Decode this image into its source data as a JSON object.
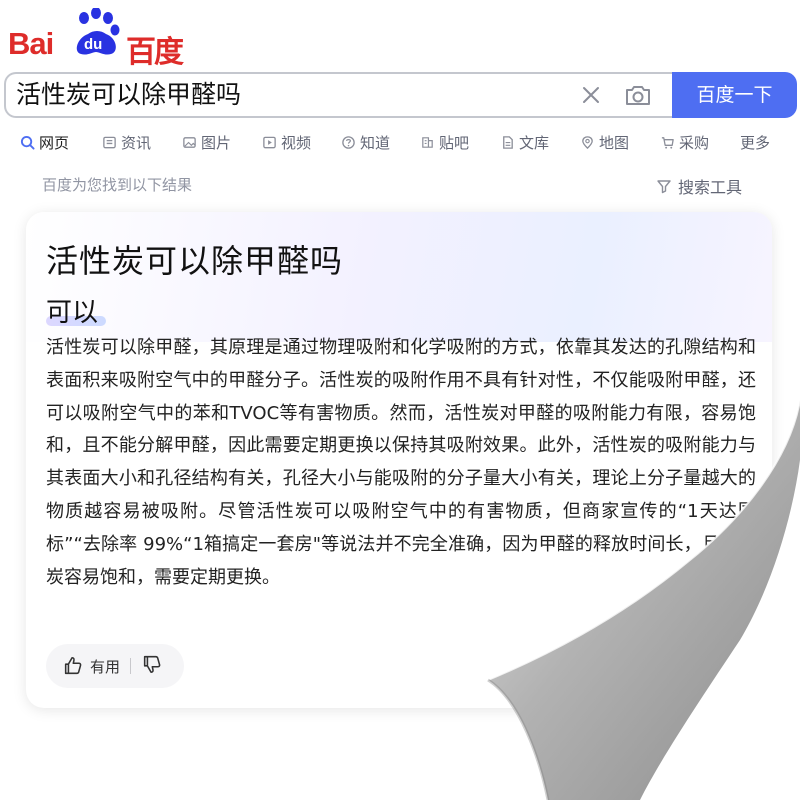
{
  "logo": {
    "text_bai": "Bai",
    "text_du": "du",
    "text_cn": "百度"
  },
  "search": {
    "query": "活性炭可以除甲醛吗",
    "button_label": "百度一下"
  },
  "tabs": [
    {
      "label": "网页",
      "icon": "search-icon"
    },
    {
      "label": "资讯",
      "icon": "news-icon"
    },
    {
      "label": "图片",
      "icon": "image-icon"
    },
    {
      "label": "视频",
      "icon": "video-icon"
    },
    {
      "label": "知道",
      "icon": "question-icon"
    },
    {
      "label": "贴吧",
      "icon": "tieba-icon"
    },
    {
      "label": "文库",
      "icon": "doc-icon"
    },
    {
      "label": "地图",
      "icon": "map-icon"
    },
    {
      "label": "采购",
      "icon": "cart-icon"
    },
    {
      "label": "更多",
      "icon": ""
    }
  ],
  "result_info": "百度为您找到以下结果",
  "tools_label": "搜索工具",
  "answer": {
    "title": "活性炭可以除甲醛吗",
    "short_answer": "可以",
    "body": "活性炭可以除甲醛，其原理是通过物理吸附和化学吸附的方式，依靠其发达的孔隙结构和表面积来吸附空气中的甲醛分子。活性炭的吸附作用不具有针对性，不仅能吸附甲醛，还可以吸附空气中的苯和TVOC等有害物质。然而，活性炭对甲醛的吸附能力有限，容易饱和，且不能分解甲醛，因此需要定期更换以保持其吸附效果。此外，活性炭的吸附能力与其表面大小和孔径结构有关，孔径大小与能吸附的分子量大小有关，理论上分子量越大的物质越容易被吸附。尽管活性炭可以吸附空气中的有害物质，但商家宣传的“1天达国标”“去除率 99%“1箱搞定一套房\"等说法并不完全准确，因为甲醛的释放时间长，且活性炭容易饱和，需要定期更换。",
    "useful_label": "有用"
  },
  "colors": {
    "brand_red": "#de2c2a",
    "brand_blue": "#4e6ef2",
    "paper_curl": "#a9a9a9"
  }
}
